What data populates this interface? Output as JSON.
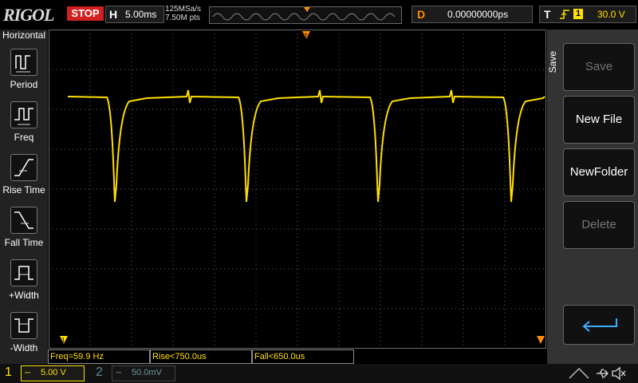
{
  "brand": "RIGOL",
  "run_state": "STOP",
  "timebase": {
    "key": "H",
    "value": "5.00ms"
  },
  "acquisition": {
    "sample_rate": "125MSa/s",
    "memory_depth": "7.50M pts"
  },
  "delay": {
    "key": "D",
    "value": "0.00000000ps"
  },
  "trigger": {
    "key": "T",
    "source": "1",
    "level": "30.0 V"
  },
  "left_menu": {
    "title": "Horizontal",
    "items": [
      {
        "label": "Period"
      },
      {
        "label": "Freq"
      },
      {
        "label": "Rise Time"
      },
      {
        "label": "Fall Time"
      },
      {
        "label": "+Width"
      },
      {
        "label": "-Width"
      }
    ]
  },
  "right_menu": {
    "title": "Save",
    "buttons": [
      {
        "label": "Save"
      },
      {
        "label": "New File"
      },
      {
        "label": "NewFolder"
      },
      {
        "label": "Delete"
      }
    ]
  },
  "measurements": [
    "Freq=59.9 Hz",
    "Rise<750.0us",
    "Fall<650.0us"
  ],
  "channels": [
    {
      "num": "1",
      "scale": "5.00 V",
      "color": "#ffe000"
    },
    {
      "num": "2",
      "scale": "50.0mV",
      "color": "#5a8a8a"
    }
  ],
  "colors": {
    "trace": "#ffe000",
    "trigger_marker": "#ff8c00",
    "grid": "#6a6a6a"
  }
}
